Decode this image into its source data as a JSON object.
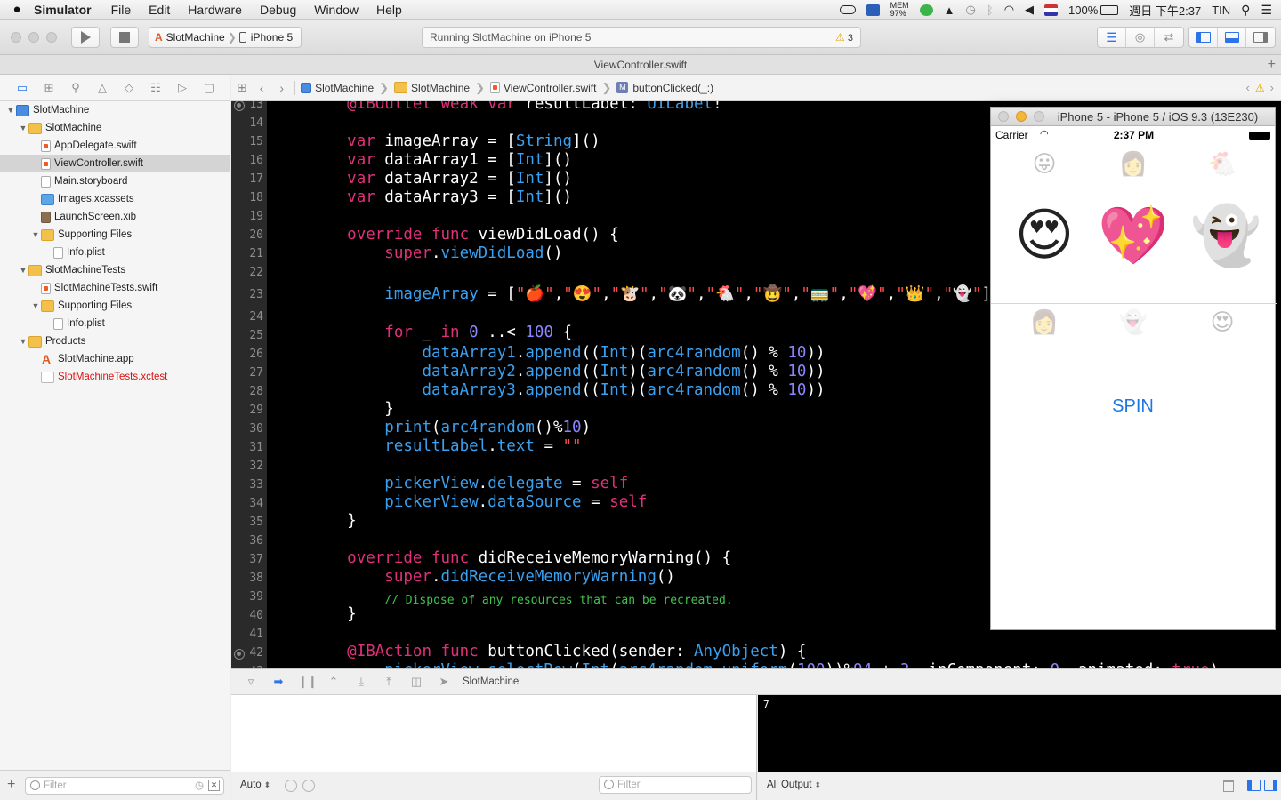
{
  "menubar": {
    "apple": "",
    "app_name": "Simulator",
    "items": [
      "File",
      "Edit",
      "Hardware",
      "Debug",
      "Window",
      "Help"
    ],
    "status": {
      "mem": "MEM\n97%",
      "battery": "100%",
      "clock": "週日 下午2:37",
      "user": "TIN"
    }
  },
  "toolbar": {
    "scheme_target": "SlotMachine",
    "scheme_device": "iPhone 5",
    "activity_text": "Running SlotMachine on iPhone 5",
    "warning_count": "3"
  },
  "tabbar": {
    "title": "ViewController.swift",
    "plus": "+"
  },
  "navigator": {
    "tree": [
      {
        "label": "SlotMachine",
        "icon": "proj",
        "disc": "▼",
        "indent": 0
      },
      {
        "label": "SlotMachine",
        "icon": "folder",
        "disc": "▼",
        "indent": 1
      },
      {
        "label": "AppDelegate.swift",
        "icon": "swift",
        "disc": "",
        "indent": 2
      },
      {
        "label": "ViewController.swift",
        "icon": "swift",
        "disc": "",
        "indent": 2,
        "selected": true
      },
      {
        "label": "Main.storyboard",
        "icon": "storyboard",
        "disc": "",
        "indent": 2
      },
      {
        "label": "Images.xcassets",
        "icon": "xcassets",
        "disc": "",
        "indent": 2
      },
      {
        "label": "LaunchScreen.xib",
        "icon": "xib",
        "disc": "",
        "indent": 2
      },
      {
        "label": "Supporting Files",
        "icon": "folder",
        "disc": "▼",
        "indent": 2
      },
      {
        "label": "Info.plist",
        "icon": "plist",
        "disc": "",
        "indent": 3
      },
      {
        "label": "SlotMachineTests",
        "icon": "folder",
        "disc": "▼",
        "indent": 1
      },
      {
        "label": "SlotMachineTests.swift",
        "icon": "swift",
        "disc": "",
        "indent": 2
      },
      {
        "label": "Supporting Files",
        "icon": "folder",
        "disc": "▼",
        "indent": 2
      },
      {
        "label": "Info.plist",
        "icon": "plist",
        "disc": "",
        "indent": 3
      },
      {
        "label": "Products",
        "icon": "folder",
        "disc": "▼",
        "indent": 1
      },
      {
        "label": "SlotMachine.app",
        "icon": "app",
        "disc": "",
        "indent": 2
      },
      {
        "label": "SlotMachineTests.xctest",
        "icon": "xctest",
        "disc": "",
        "indent": 2,
        "missing": true
      }
    ],
    "filter_placeholder": "Filter",
    "add_label": "+"
  },
  "jumpbar": {
    "crumbs": [
      "SlotMachine",
      "SlotMachine",
      "ViewController.swift",
      "buttonClicked(_:)"
    ],
    "method_badge": "M"
  },
  "editor": {
    "line_numbers": [
      "13",
      "14",
      "15",
      "16",
      "17",
      "18",
      "19",
      "20",
      "21",
      "22",
      "23",
      "24",
      "25",
      "26",
      "27",
      "28",
      "29",
      "30",
      "31",
      "32",
      "33",
      "34",
      "35",
      "36",
      "37",
      "38",
      "39",
      "40",
      "41",
      "42",
      "43"
    ]
  },
  "simulator": {
    "title": "iPhone 5 - iPhone 5 / iOS 9.3 (13E230)",
    "carrier": "Carrier",
    "time": "2:37 PM",
    "spin_label": "SPIN",
    "emoji_top": [
      "😛",
      "👩",
      "🐔"
    ],
    "emoji_center": [
      "😍",
      "💖",
      "👻"
    ],
    "emoji_bottom": [
      "👩",
      "👻",
      "😍"
    ]
  },
  "debug": {
    "process": "SlotMachine",
    "console_output": "7",
    "auto_label": "Auto",
    "filter_placeholder": "Filter",
    "output_label": "All Output"
  },
  "colors": {
    "keyword": "#e0307a",
    "type": "#3aa0f0",
    "number": "#8b86ff",
    "string": "#ff4b4b",
    "comment": "#3fc44f",
    "selection": "#d4d4d4",
    "accent": "#2d73e8"
  }
}
